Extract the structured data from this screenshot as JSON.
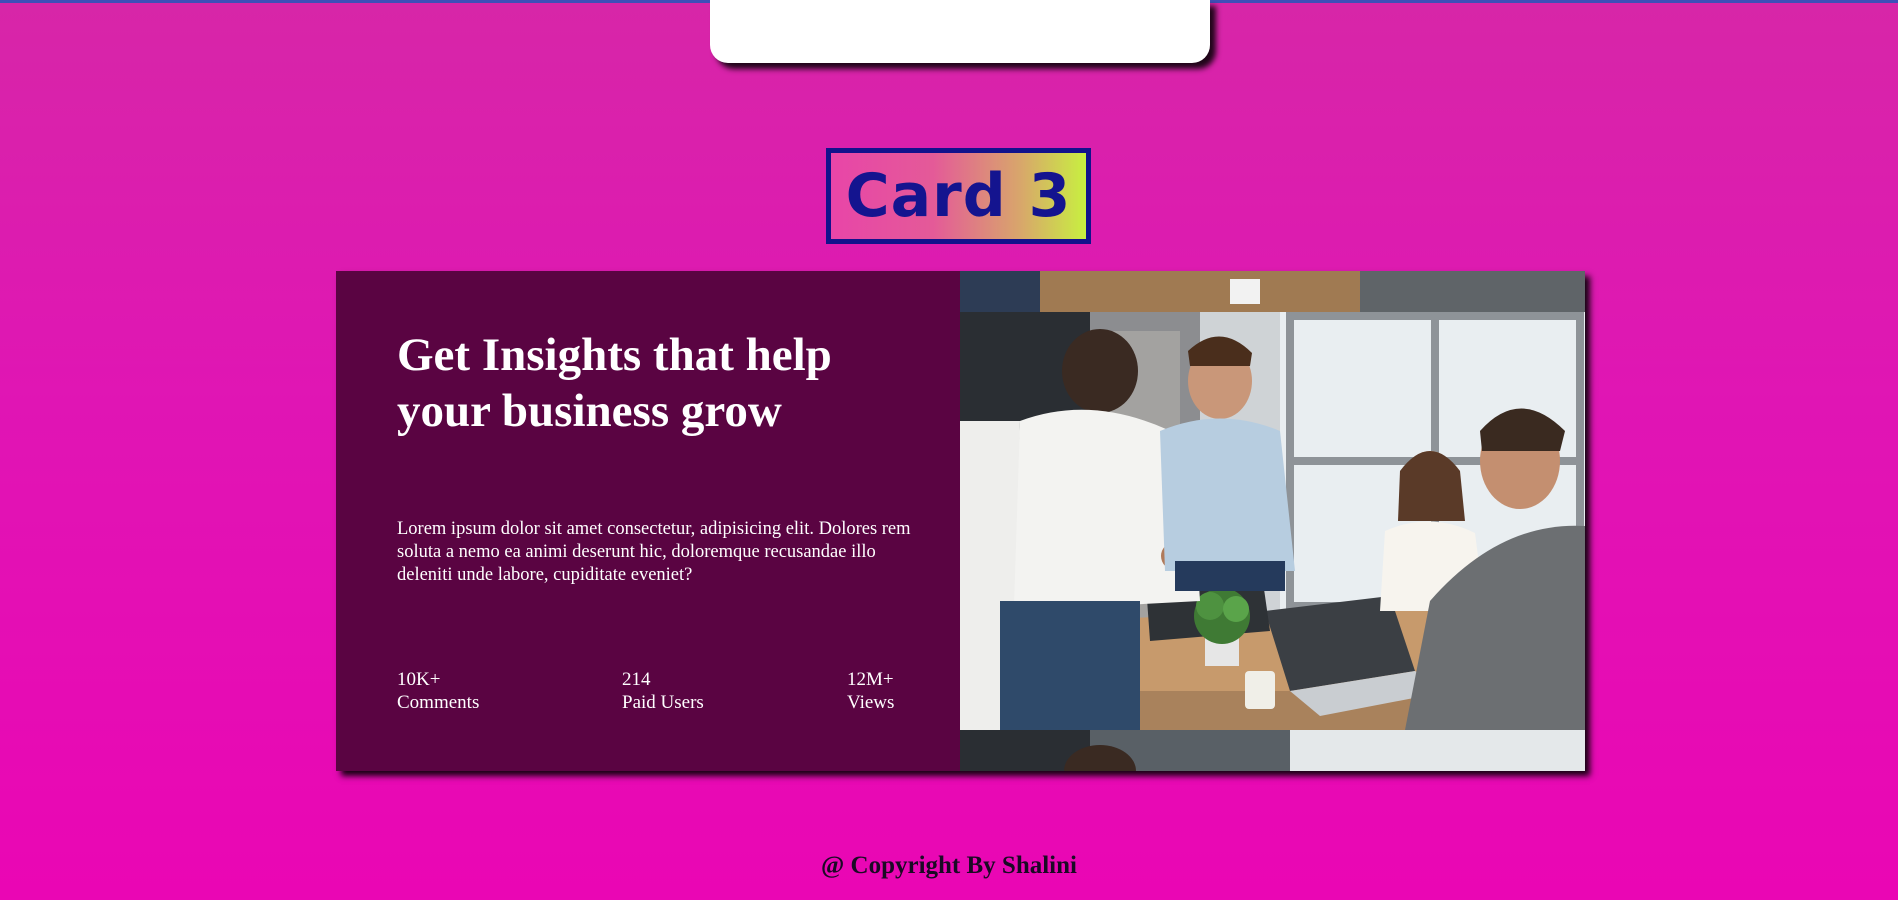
{
  "badge": {
    "label": "Card 3"
  },
  "feature": {
    "headline": "Get Insights that help your business grow",
    "body": "Lorem ipsum dolor sit amet consectetur, adipisicing elit. Dolores rem soluta a nemo ea animi deserunt hic, doloremque recusandae illo deleniti unde labore, cupiditate eveniet?",
    "stats": [
      {
        "value": "10K+",
        "label": "Comments"
      },
      {
        "value": "214",
        "label": "Paid Users"
      },
      {
        "value": "12M+",
        "label": "Views"
      }
    ],
    "image": {
      "icon": "business-meeting-photo"
    }
  },
  "footer": {
    "text": "@ Copyright By Shalini"
  },
  "colors": {
    "page_background": "#e015b4",
    "panel": "#5a0442",
    "badge_border": "#12128c",
    "badge_text": "#14148f",
    "top_line": "#3f4fb8"
  }
}
